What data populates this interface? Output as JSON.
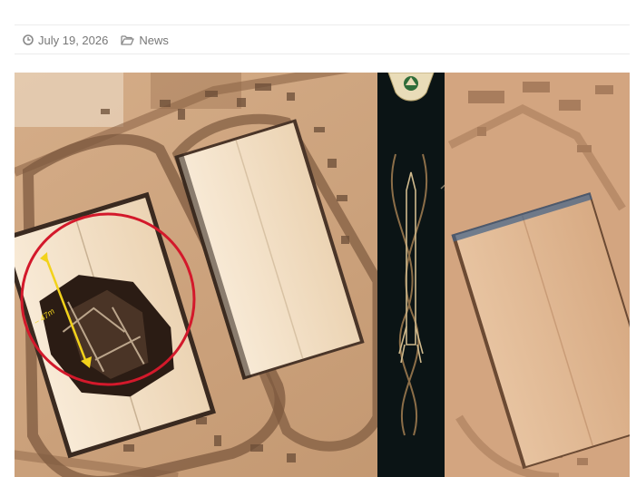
{
  "post": {
    "title": "",
    "date": "July 19, 2026",
    "category": "News"
  },
  "icons": {
    "date": "clock-icon",
    "category": "folder-icon"
  },
  "image": {
    "annotation_label": "~ 47m",
    "colors": {
      "ground": "#c79a74",
      "roof": "#f3e2cb",
      "circle": "#d3192b",
      "measure": "#f2d21b",
      "banner": "#0b1415"
    }
  }
}
